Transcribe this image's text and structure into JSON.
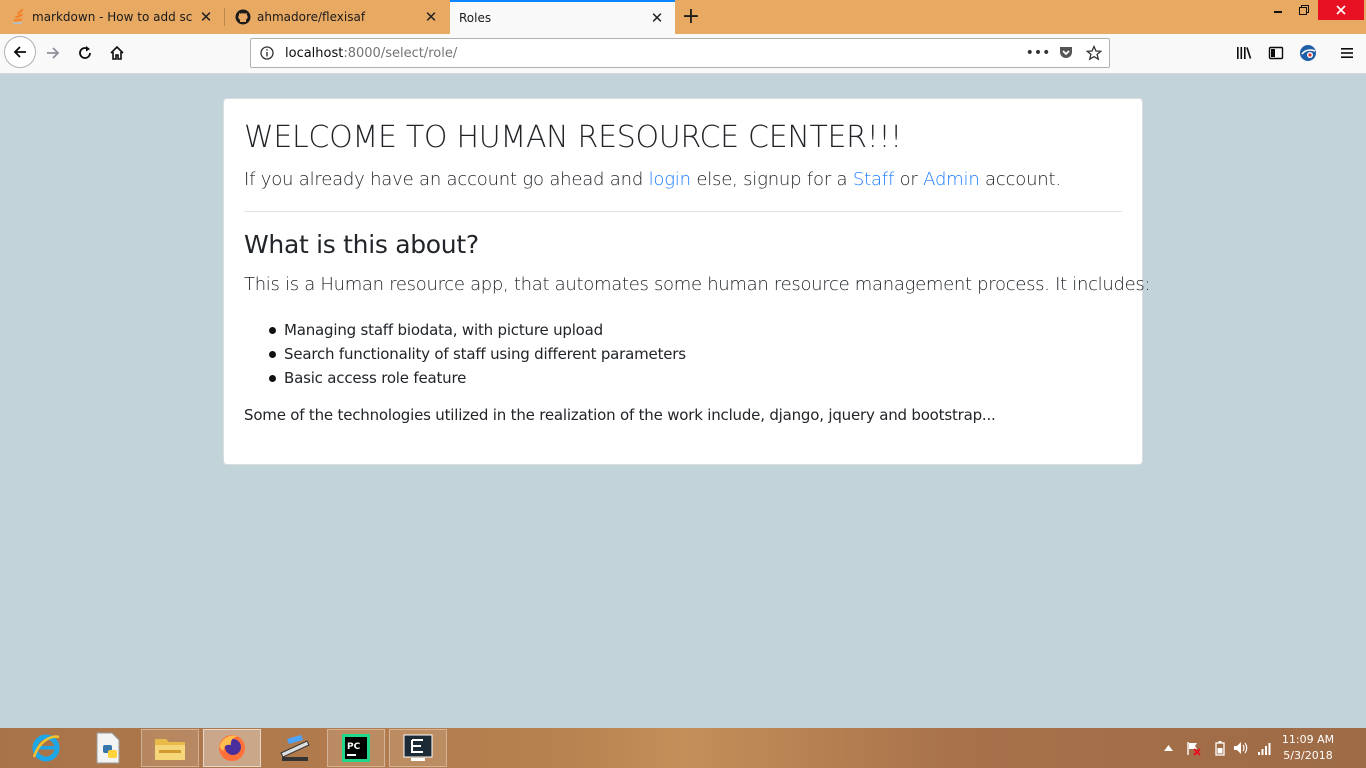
{
  "browser": {
    "tabs": [
      {
        "title": "markdown - How to add screen",
        "icon": "stackoverflow-icon",
        "active": false
      },
      {
        "title": "ahmadore/flexisaf",
        "icon": "github-icon",
        "active": false
      },
      {
        "title": "Roles",
        "icon": "",
        "active": true
      }
    ],
    "new_tab_label": "+",
    "url_host": "localhost",
    "url_rest": ":8000/select/role/",
    "more_label": "•••"
  },
  "page": {
    "title": "WELCOME TO HUMAN RESOURCE CENTER!!!",
    "lead_before": "If you already have an account go ahead and ",
    "login_link": "login",
    "lead_middle": " else, signup for a ",
    "staff_link": "Staff",
    "lead_or": " or ",
    "admin_link": "Admin",
    "lead_after": " account.",
    "about_heading": "What is this about?",
    "about_text": "This is a Human resource app, that automates some human resource management process. It includes:",
    "features": [
      "Managing staff biodata, with picture upload",
      "Search functionality of staff using different parameters",
      "Basic access role feature"
    ],
    "technologies": "Some of the technologies utilized in the realization of the work include, django, jquery and bootstrap..."
  },
  "taskbar": {
    "apps": [
      "internet-explorer-icon",
      "python-file-icon",
      "file-explorer-icon",
      "firefox-icon",
      "scanner-icon",
      "pycharm-icon",
      "editor-icon"
    ],
    "time": "11:09 AM",
    "date": "5/3/2018"
  },
  "colors": {
    "tab_bar": "#e8a963",
    "page_background": "#c2d4da",
    "link": "#1a7bff",
    "accent": "#0a84ff"
  }
}
